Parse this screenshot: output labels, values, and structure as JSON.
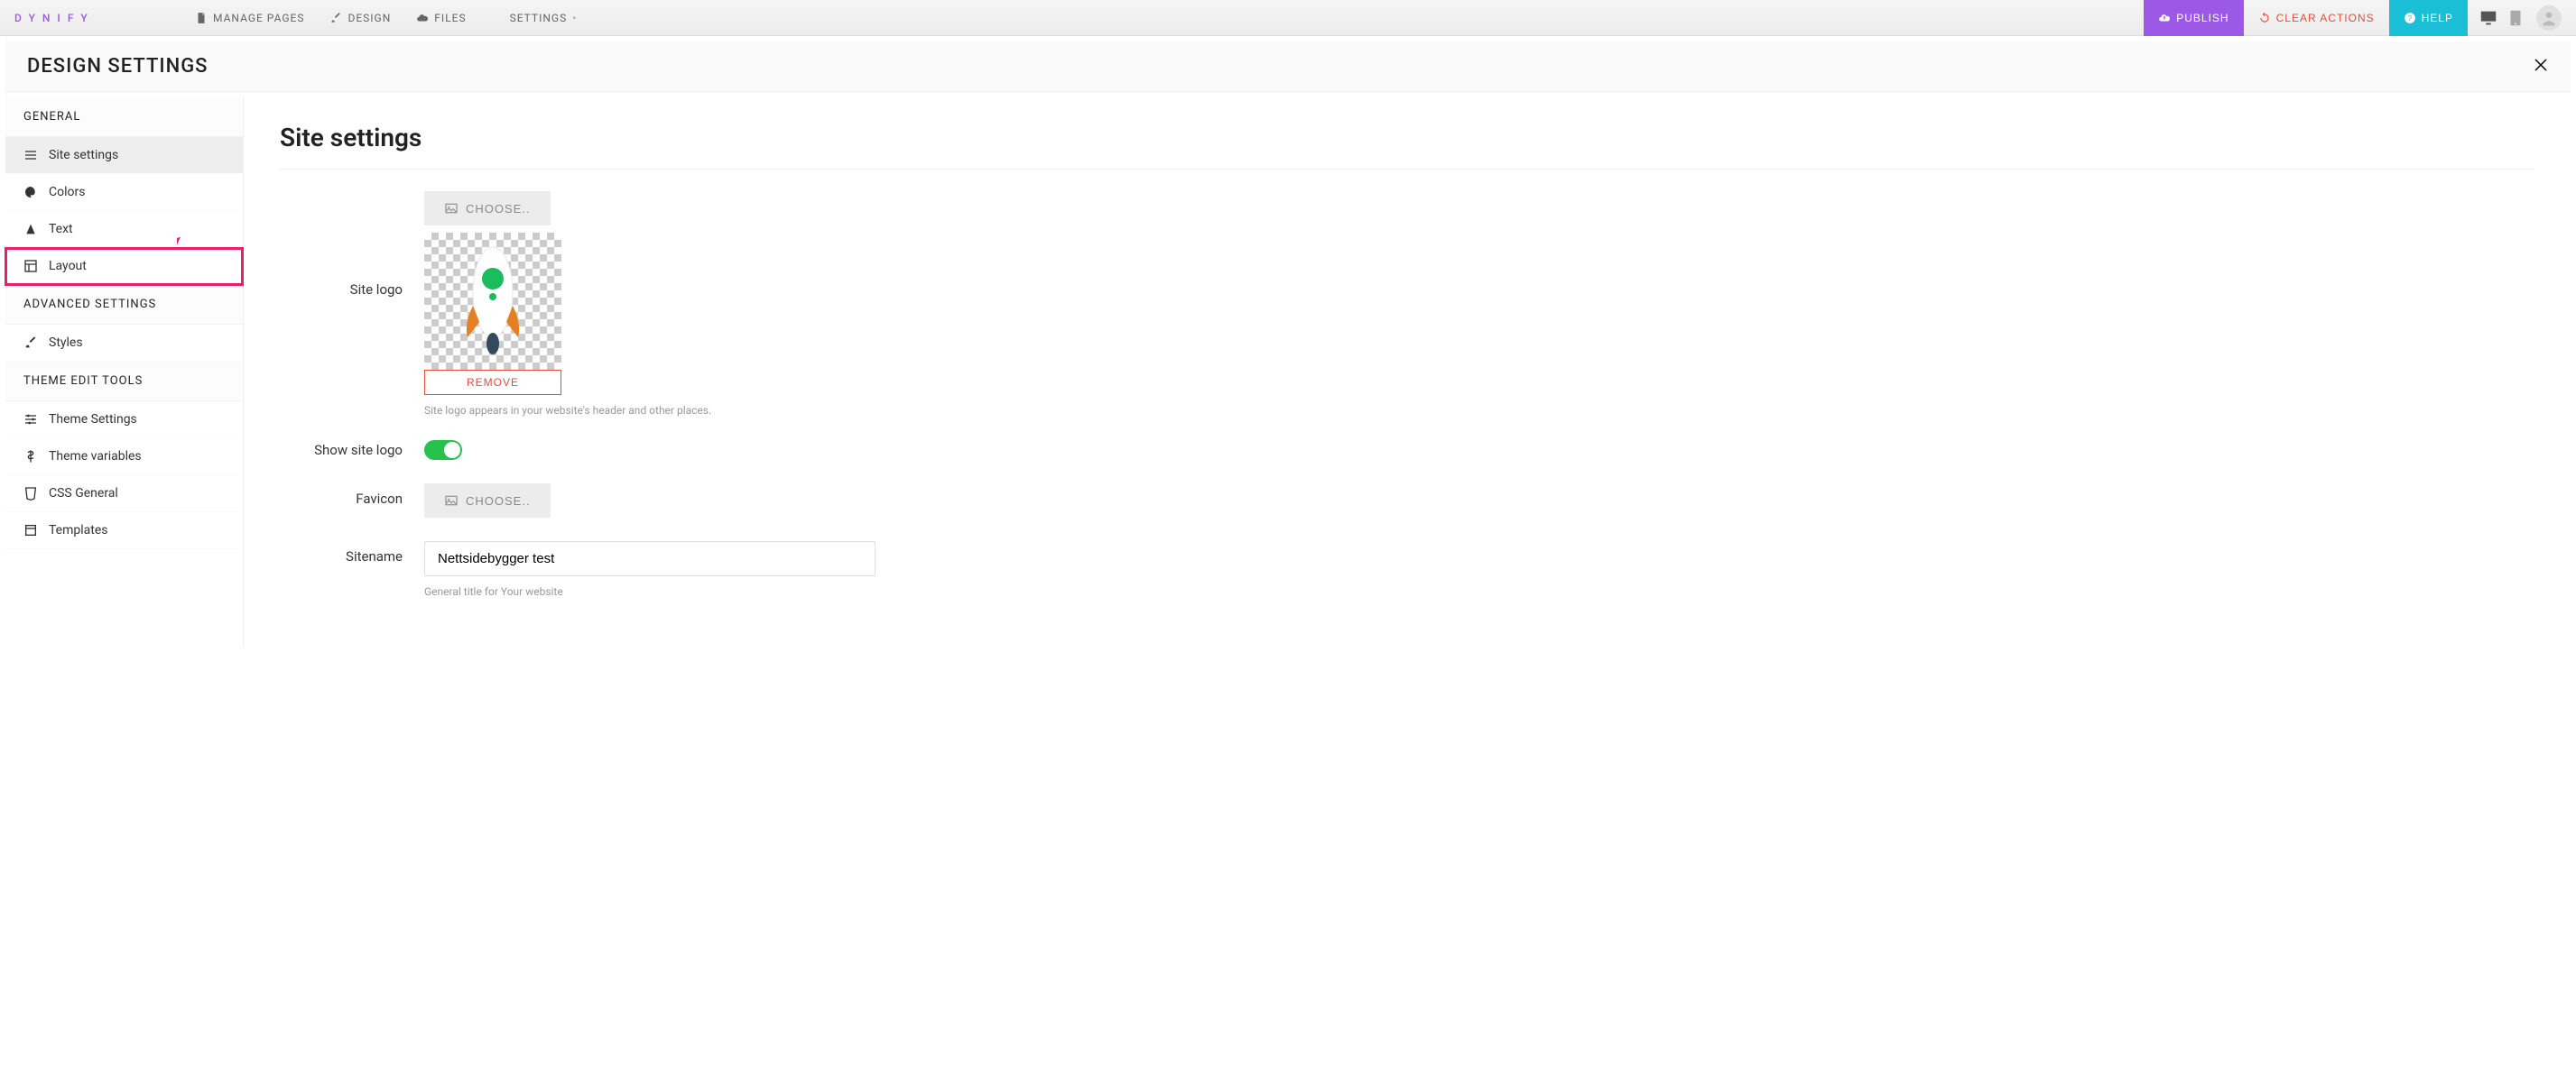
{
  "brand": "DYNIFY",
  "topnav": {
    "manage_pages": "MANAGE PAGES",
    "design": "DESIGN",
    "files": "FILES",
    "settings": "SETTINGS"
  },
  "actions": {
    "publish": "PUBLISH",
    "clear": "CLEAR ACTIONS",
    "help": "HELP"
  },
  "panel": {
    "title": "DESIGN SETTINGS"
  },
  "sidebar": {
    "sections": {
      "general": "GENERAL",
      "advanced": "ADVANCED SETTINGS",
      "theme_tools": "THEME EDIT TOOLS"
    },
    "items": {
      "site_settings": "Site settings",
      "colors": "Colors",
      "text": "Text",
      "layout": "Layout",
      "styles": "Styles",
      "theme_settings": "Theme Settings",
      "theme_variables": "Theme variables",
      "css_general": "CSS General",
      "templates": "Templates"
    }
  },
  "main": {
    "title": "Site settings",
    "site_logo_label": "Site logo",
    "choose": "CHOOSE..",
    "remove": "REMOVE",
    "logo_help": "Site logo appears in your website's header and other places.",
    "show_logo_label": "Show site logo",
    "favicon_label": "Favicon",
    "sitename_label": "Sitename",
    "sitename_value": "Nettsidebygger test",
    "sitename_help": "General title for Your website"
  }
}
